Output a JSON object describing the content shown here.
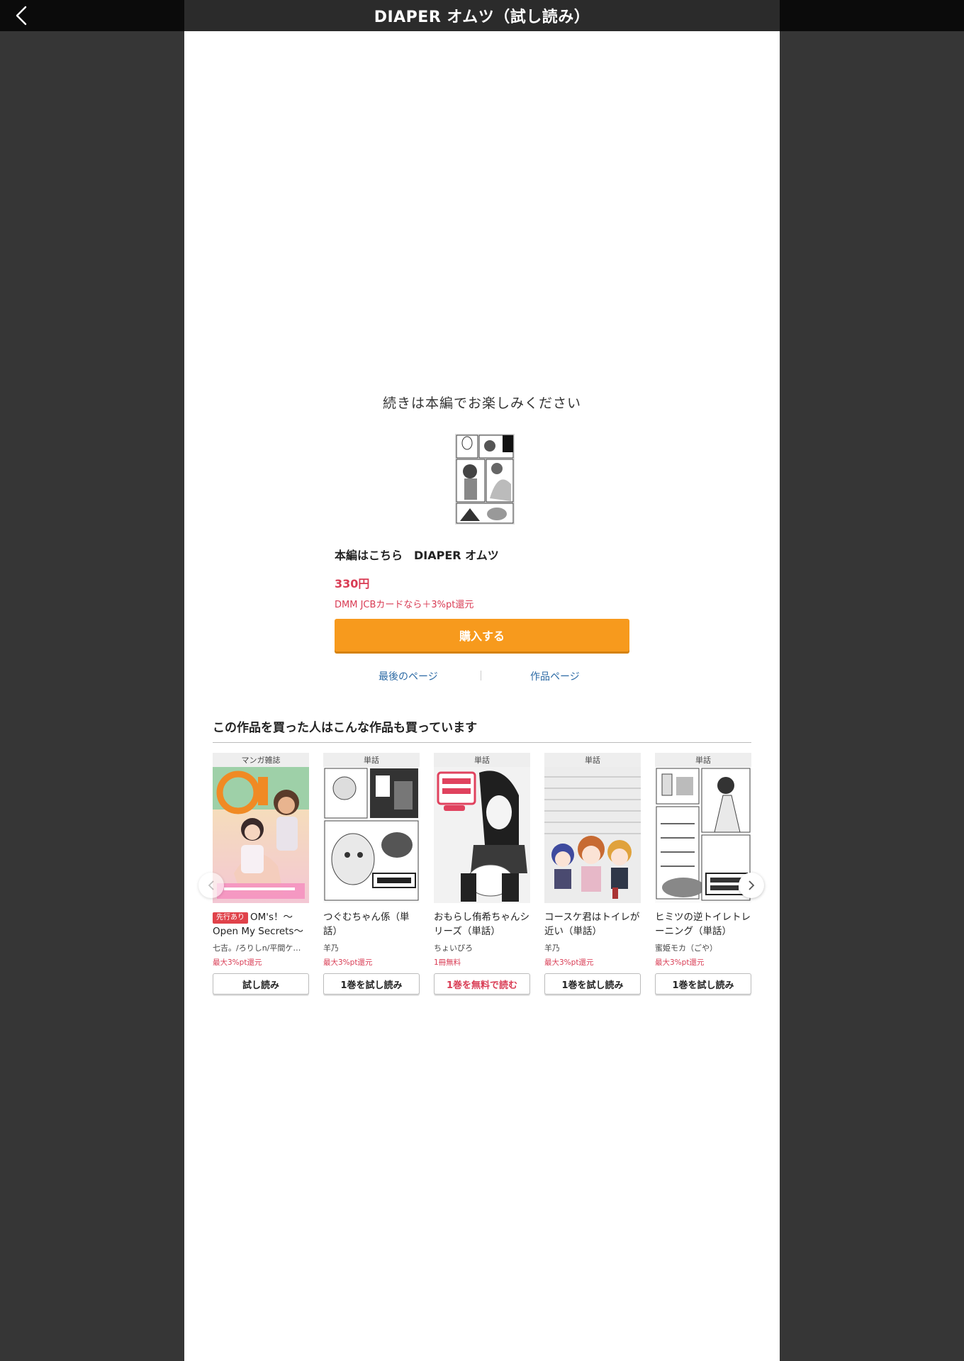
{
  "header": {
    "title": "DIAPER オムツ（試し読み）"
  },
  "end_notice": {
    "message": "続きは本編でお楽しみください"
  },
  "purchase": {
    "label": "本編はこちら",
    "title": "DIAPER オムツ",
    "price": "330円",
    "campaign": "DMM JCBカードなら＋3%pt還元",
    "buy_button": "購入する"
  },
  "links": {
    "last_page": "最後のページ",
    "work_page": "作品ページ"
  },
  "recommendations": {
    "heading": "この作品を買った人はこんな作品も買っています",
    "items": [
      {
        "category": "マンガ雑誌",
        "badge": "先行あり",
        "title": "OM's！～Open My Secrets～",
        "author": "七吉。/ろりしn/平間ケ…",
        "points": "最大3%pt還元",
        "button": "試し読み"
      },
      {
        "category": "単話",
        "title": "つぐむちゃん係（単話）",
        "author": "羊乃",
        "points": "最大3%pt還元",
        "button": "1巻を試し読み"
      },
      {
        "category": "単話",
        "title": "おもらし侑希ちゃんシリーズ（単話）",
        "author": "ちょいぴろ",
        "points": "1冊無料",
        "button": "1巻を無料で読む"
      },
      {
        "category": "単話",
        "title": "コースケ君はトイレが近い（単話）",
        "author": "羊乃",
        "points": "最大3%pt還元",
        "button": "1巻を試し読み"
      },
      {
        "category": "単話",
        "title": "ヒミツの逆トイレトレーニング（単話）",
        "author": "蜜姫モカ（ごや）",
        "points": "最大3%pt還元",
        "button": "1巻を試し読み"
      }
    ]
  },
  "icons": {
    "back": "chevron-left-icon",
    "carousel_prev": "chevron-left-icon",
    "carousel_next": "chevron-right-icon"
  },
  "colors": {
    "accent_orange": "#f79a1d",
    "price_red": "#d93c54",
    "link_blue": "#2c6aa5",
    "header_black": "#0b0b0b"
  }
}
